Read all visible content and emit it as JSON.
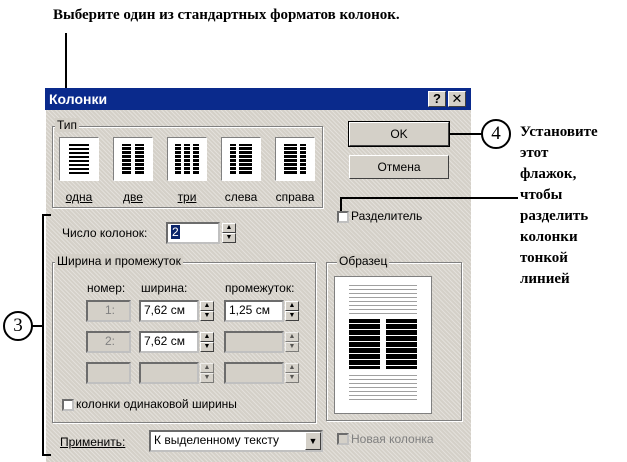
{
  "caption": "Выберите один из стандартных форматов колонок.",
  "dialog": {
    "title": "Колонки",
    "help_btn": "?",
    "close_btn": "✕",
    "type_group": {
      "label": "Тип",
      "presets": [
        {
          "label": "одна"
        },
        {
          "label": "две"
        },
        {
          "label": "три"
        },
        {
          "label": "слева"
        },
        {
          "label": "справа"
        }
      ]
    },
    "ok_label": "OK",
    "cancel_label": "Отмена",
    "separator_label": "Разделитель",
    "num_columns_label": "Число колонок:",
    "num_columns_value": "2",
    "width_group": {
      "label": "Ширина и промежуток",
      "col_number": "номер:",
      "col_width": "ширина:",
      "col_gap": "промежуток:",
      "rows": [
        {
          "num": "1:",
          "width": "7,62 см",
          "gap": "1,25 см"
        },
        {
          "num": "2:",
          "width": "7,62 см",
          "gap": ""
        },
        {
          "num": "",
          "width": "",
          "gap": ""
        }
      ]
    },
    "equal_width_label": "колонки одинаковой ширины",
    "preview_label": "Образец",
    "apply_label": "Применить:",
    "apply_value": "К выделенному тексту",
    "new_column_label": "Новая колонка"
  },
  "callouts": {
    "n3": "3",
    "n4": "4",
    "text4_lines": [
      "Установите",
      "этот",
      "флажок,",
      "чтобы",
      "разделить",
      "колонки",
      "тонкой",
      "линией"
    ]
  }
}
